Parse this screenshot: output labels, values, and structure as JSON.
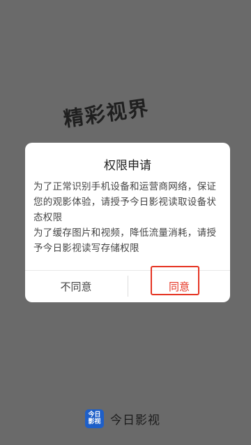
{
  "splash": {
    "slogan_line1": "精彩视界",
    "slogan_line2": "...",
    "brand_name": "今日影视",
    "logo_text_top": "今日",
    "logo_text_bottom": "影视"
  },
  "dialog": {
    "title": "权限申请",
    "paragraph1": "为了正常识别手机设备和运营商网络，保证您的观影体验，请授予今日影视读取设备状态权限",
    "paragraph2": "为了缓存图片和视频，降低流量消耗，请授予今日影视读写存储权限",
    "disagree_label": "不同意",
    "agree_label": "同意"
  },
  "colors": {
    "overlay_bg": "#6a6a6a",
    "agree_text": "#e53322",
    "highlight_border": "#e53322",
    "logo_blue": "#1e5fc8"
  }
}
